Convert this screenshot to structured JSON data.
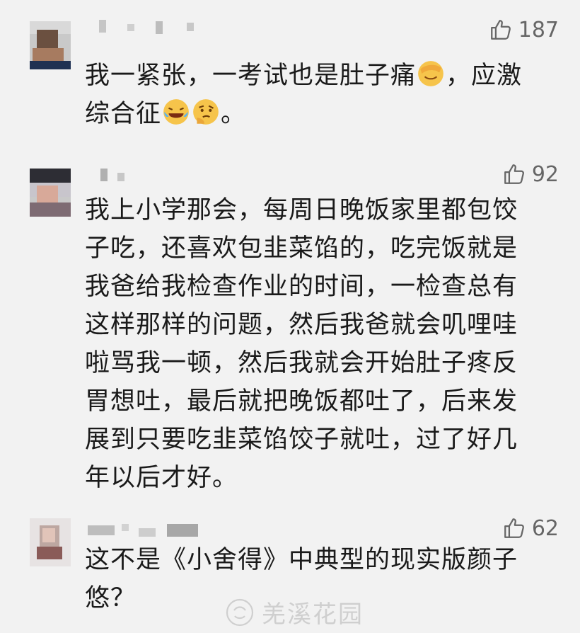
{
  "comments": [
    {
      "likes": "187",
      "text_parts": [
        "我一紧张，一考试也是肚子痛",
        "，应激",
        "综合征",
        "。"
      ],
      "emojis": [
        "facepalm-emoji",
        "laughing-tears-emoji",
        "thinking-emoji"
      ]
    },
    {
      "likes": "92",
      "lines": [
        "我上小学那会，每周日晚饭家里都包饺",
        "子吃，还喜欢包韭菜馅的，吃完饭就是",
        "我爸给我检查作业的时间，一检查总有",
        "这样那样的问题，然后我爸就会叽哩哇",
        "啦骂我一顿，然后我就会开始肚子疼反",
        "胃想吐，最后就把晚饭都吐了，后来发",
        "展到只要吃韭菜馅饺子就吐，过了好几",
        "年以后才好。"
      ]
    },
    {
      "likes": "62",
      "lines": [
        "这不是《小舍得》中典型的现实版颜子",
        "悠？"
      ]
    }
  ],
  "watermark": "羌溪花园",
  "icons": {
    "like": "thumbs-up-icon",
    "avatar": "pixelated-avatar",
    "username": "pixelated-username"
  },
  "colors": {
    "background": "#f2f2f2",
    "text": "#1a1a1a",
    "meta": "#666666"
  }
}
